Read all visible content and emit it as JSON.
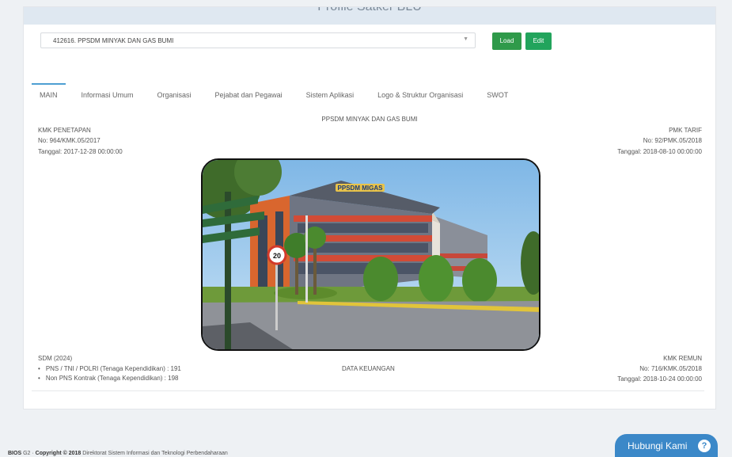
{
  "header": {
    "title": "Profile Satker BLU"
  },
  "selector": {
    "value": "412616. PPSDM MINYAK DAN GAS BUMI"
  },
  "buttons": {
    "load": "Load",
    "edit": "Edit"
  },
  "tabs": [
    {
      "label": "MAIN",
      "active": true
    },
    {
      "label": "Informasi Umum"
    },
    {
      "label": "Organisasi"
    },
    {
      "label": "Pejabat dan Pegawai"
    },
    {
      "label": "Sistem Aplikasi"
    },
    {
      "label": "Logo & Struktur Organisasi"
    },
    {
      "label": "SWOT"
    }
  ],
  "main": {
    "name": "PPSDM MINYAK DAN GAS BUMI",
    "kmk_penetapan": {
      "title": "KMK PENETAPAN",
      "no": "No: 964/KMK.05/2017",
      "tanggal": "Tanggal: 2017-12-28 00:00:00"
    },
    "pmk_tarif": {
      "title": "PMK TARIF",
      "no": "No: 92/PMK.05/2018",
      "tanggal": "Tanggal: 2018-08-10 00:00:00"
    },
    "sdm": {
      "title": "SDM (2024)",
      "items": [
        "PNS / TNI / POLRI (Tenaga Kependidikan) : 191",
        "Non PNS Kontrak (Tenaga Kependidikan) : 198"
      ]
    },
    "data_keuangan": "DATA KEUANGAN",
    "kmk_remun": {
      "title": "KMK REMUN",
      "no": "No: 716/KMK.05/2018",
      "tanggal": "Tanggal: 2018-10-24 00:00:00"
    },
    "building_sign": "PPSDM MIGAS",
    "speed_sign": "20"
  },
  "footer": {
    "brand": "BIOS",
    "version": " G2 · ",
    "copyright": "Copyright © 2018",
    "org": " Direktorat Sistem Informasi dan Teknologi Perbendaharaan"
  },
  "help": {
    "label": "Hubungi Kami",
    "icon": "question-icon"
  },
  "colors": {
    "accent": "#3b88c8",
    "load_button": "#2f9a4a",
    "edit_button": "#22a45c",
    "tab_indicator": "#4e9fd3"
  }
}
